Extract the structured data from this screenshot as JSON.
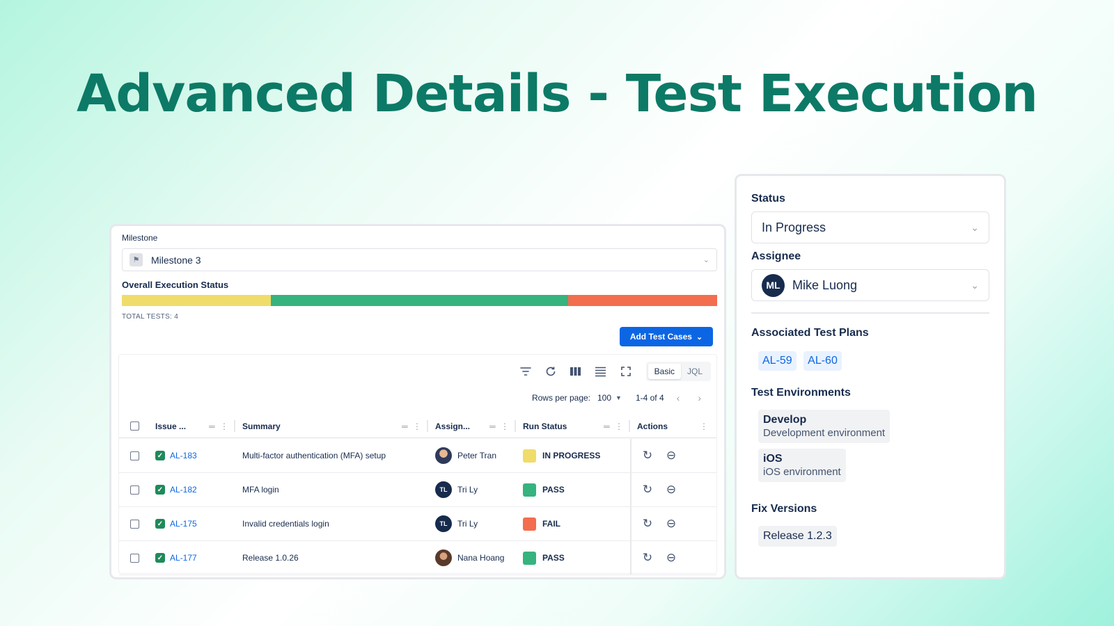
{
  "hero": {
    "title": "Advanced Details - Test Execution"
  },
  "milestone": {
    "label": "Milestone",
    "value": "Milestone 3",
    "icon": "flag-icon"
  },
  "execution": {
    "label": "Overall Execution Status",
    "segments": [
      {
        "status": "IN PROGRESS",
        "fraction": 0.25,
        "color": "#f0dc6a"
      },
      {
        "status": "PASS",
        "fraction": 0.5,
        "color": "#36b37e"
      },
      {
        "status": "FAIL",
        "fraction": 0.25,
        "color": "#f36d4f"
      }
    ],
    "total_tests": "TOTAL TESTS: 4"
  },
  "add_button": {
    "label": "Add Test Cases"
  },
  "toolbar": {
    "icons": [
      "filter-icon",
      "refresh-icon",
      "columns-icon",
      "density-icon",
      "fullscreen-icon"
    ],
    "mode_basic": "Basic",
    "mode_jql": "JQL"
  },
  "pager": {
    "rows_label": "Rows per page:",
    "rows_value": "100",
    "range": "1-4 of 4"
  },
  "table": {
    "headers": {
      "issue": "Issue ...",
      "summary": "Summary",
      "assignee": "Assign...",
      "run_status": "Run Status",
      "actions": "Actions"
    },
    "rows": [
      {
        "key": "AL-183",
        "summary": "Multi-factor authentication (MFA) setup",
        "assignee": "Peter Tran",
        "avatar": "photo1",
        "initials": "",
        "status": "IN PROGRESS",
        "status_color": "#f0dc6a"
      },
      {
        "key": "AL-182",
        "summary": "MFA login",
        "assignee": "Tri Ly",
        "avatar": "dark",
        "initials": "TL",
        "status": "PASS",
        "status_color": "#36b37e"
      },
      {
        "key": "AL-175",
        "summary": "Invalid credentials login",
        "assignee": "Tri Ly",
        "avatar": "dark",
        "initials": "TL",
        "status": "FAIL",
        "status_color": "#f36d4f"
      },
      {
        "key": "AL-177",
        "summary": "Release 1.0.26",
        "assignee": "Nana Hoang",
        "avatar": "photo2",
        "initials": "",
        "status": "PASS",
        "status_color": "#36b37e"
      }
    ]
  },
  "details": {
    "status_label": "Status",
    "status_value": "In Progress",
    "assignee_label": "Assignee",
    "assignee_initials": "ML",
    "assignee_value": "Mike Luong",
    "plans_label": "Associated Test Plans",
    "plans": [
      "AL-59",
      "AL-60"
    ],
    "env_label": "Test Environments",
    "environments": [
      {
        "name": "Develop",
        "description": "Development environment"
      },
      {
        "name": "iOS",
        "description": "iOS environment"
      }
    ],
    "fix_label": "Fix Versions",
    "fix_versions": [
      "Release 1.2.3"
    ]
  },
  "colors": {
    "accent": "#0c66e4",
    "title": "#0c7a66"
  }
}
